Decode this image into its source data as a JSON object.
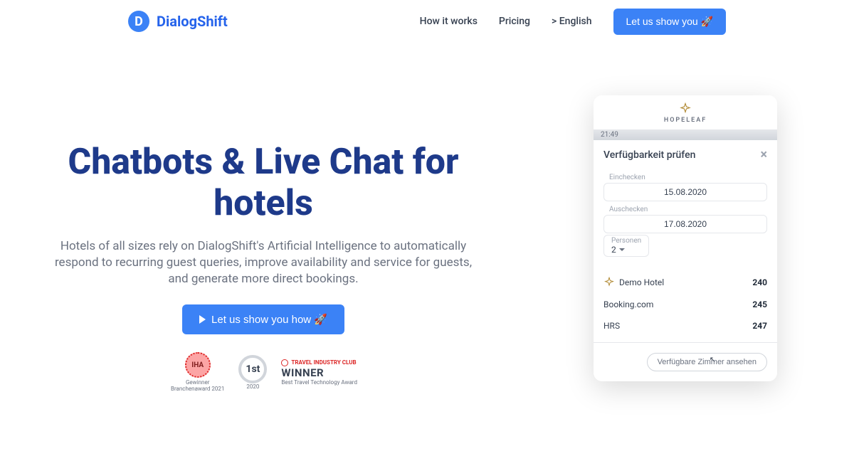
{
  "header": {
    "logo_letter": "D",
    "logo_text": "DialogShift",
    "nav": {
      "how": "How it works",
      "pricing": "Pricing",
      "lang": "> English"
    },
    "cta": "Let us show you 🚀"
  },
  "hero": {
    "title": "Chatbots & Live Chat for hotels",
    "subtitle": "Hotels of all sizes rely on DialogShift's Artificial Intelligence to automatically respond to recurring guest queries, improve availability and service for guests, and generate more direct bookings.",
    "button": "Let us show you how 🚀"
  },
  "awards": {
    "iha_badge": "IHA",
    "iha_line1": "Gewinner",
    "iha_line2": "Branchenaward 2021",
    "first_value": "1st",
    "first_year": "2020",
    "winner_brand": "TRAVEL INDUSTRY CLUB",
    "winner_title": "WINNER",
    "winner_sub": "Best Travel Technology Award"
  },
  "widget": {
    "brand": "HOPELEAF",
    "time": "21:49",
    "title": "Verfügbarkeit prüfen",
    "checkin_label": "Einchecken",
    "checkin_value": "15.08.2020",
    "checkout_label": "Auschecken",
    "checkout_value": "17.08.2020",
    "persons_label": "Personen",
    "persons_value": "2",
    "prices": [
      {
        "name": "Demo Hotel",
        "value": "240"
      },
      {
        "name": "Booking.com",
        "value": "245"
      },
      {
        "name": "HRS",
        "value": "247"
      }
    ],
    "view_button": "Verfügbare Zimmer ansehen"
  }
}
